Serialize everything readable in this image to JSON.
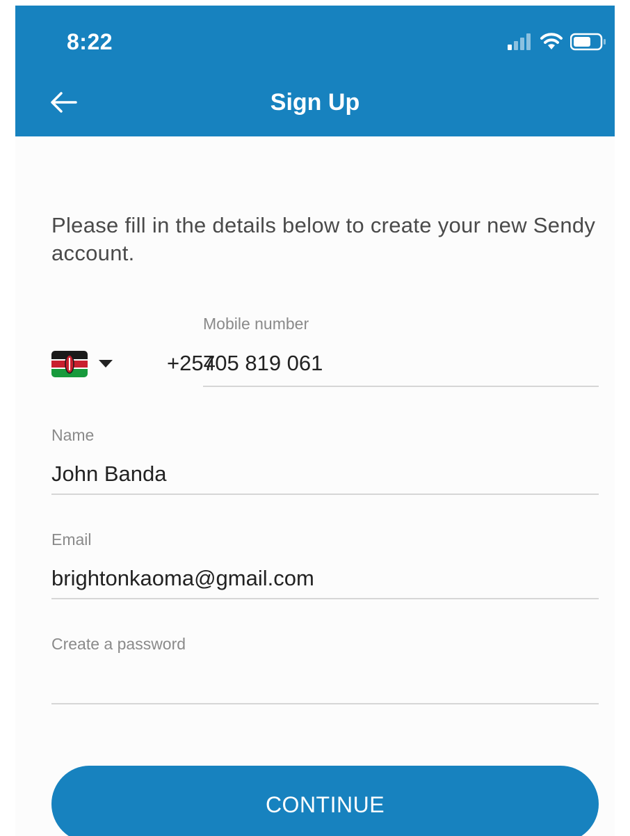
{
  "status_bar": {
    "time": "8:22",
    "icons": [
      "signal-icon",
      "wifi-icon",
      "battery-icon"
    ]
  },
  "header": {
    "title": "Sign Up",
    "back_icon": "arrow-left-icon"
  },
  "intro_text": "Please fill in the details below to create your new Sendy account.",
  "form": {
    "mobile": {
      "label": "Mobile number",
      "country_flag": "kenya-flag-icon",
      "dial_code": "+254",
      "value": "705 819 061"
    },
    "name": {
      "label": "Name",
      "value": "John Banda"
    },
    "email": {
      "label": "Email",
      "value": "brightonkaoma@gmail.com"
    },
    "password": {
      "label": "Create a password",
      "value": ""
    }
  },
  "continue_label": "CONTINUE",
  "colors": {
    "primary": "#1782bf",
    "background": "#fcfcfc",
    "label": "#8a8a8a",
    "text": "#222222"
  }
}
